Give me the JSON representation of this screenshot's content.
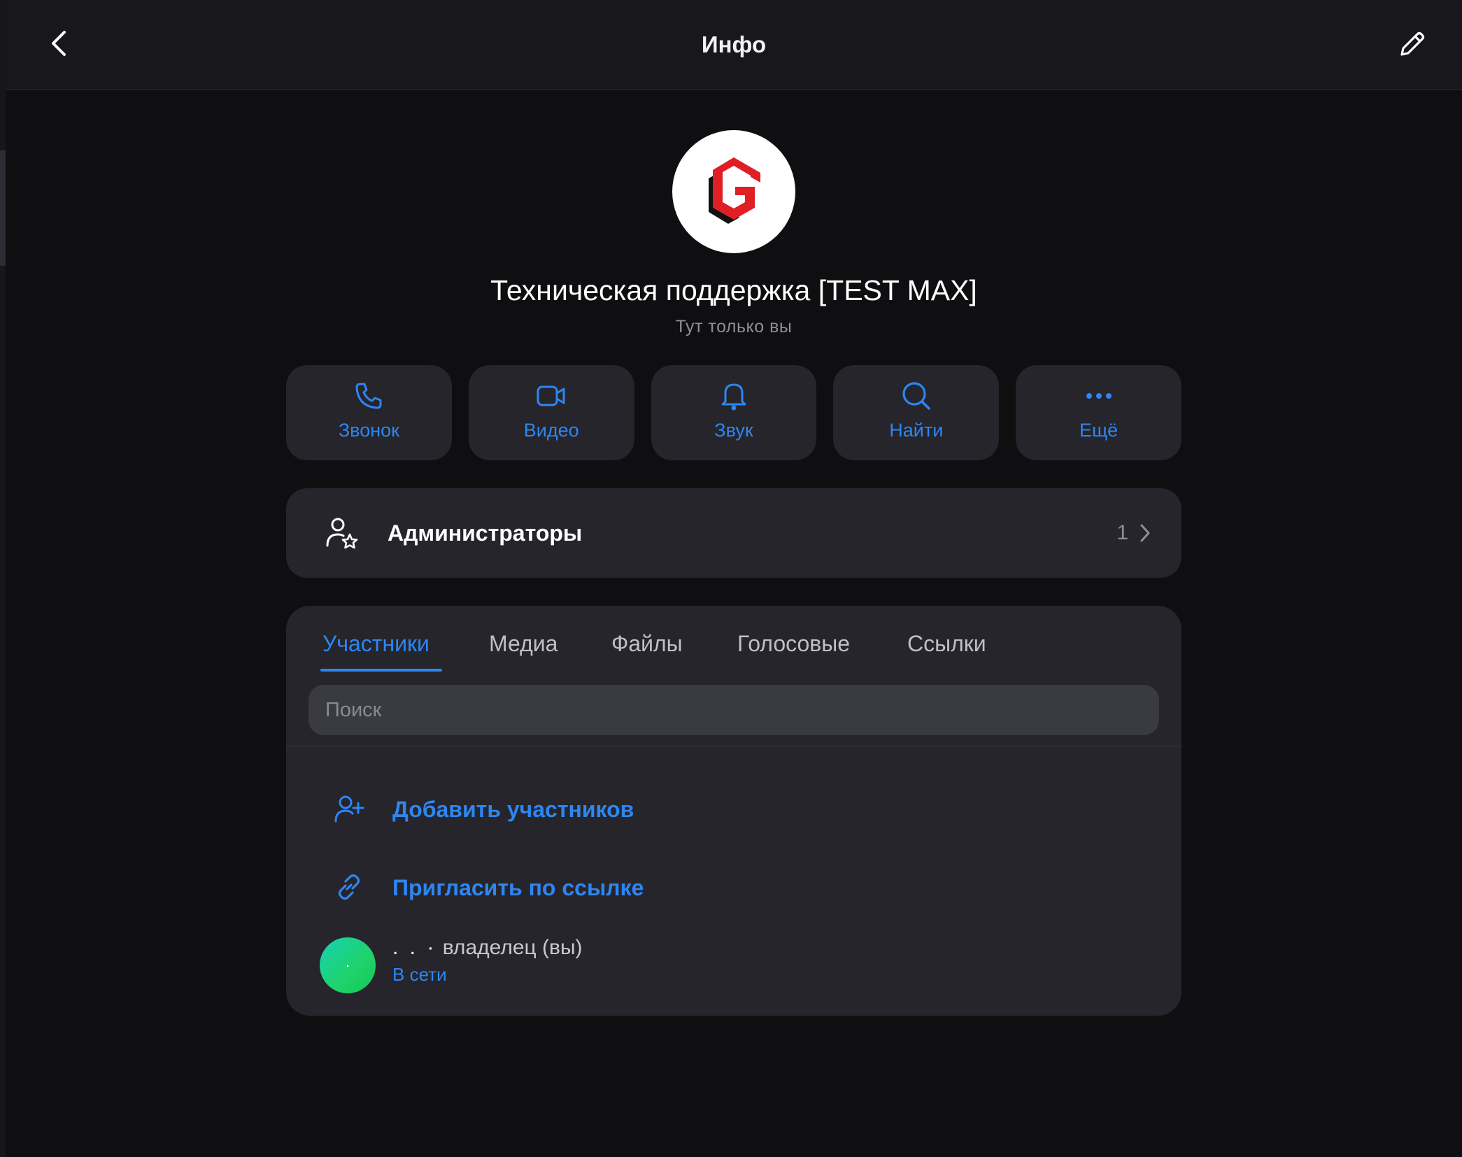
{
  "header": {
    "title": "Инфо",
    "back_icon": "chevron-left-icon",
    "edit_icon": "pencil-icon"
  },
  "group": {
    "name": "Техническая поддержка [TEST MAX]",
    "subtitle": "Тут только вы"
  },
  "actions": [
    {
      "label": "Звонок",
      "icon": "phone-icon"
    },
    {
      "label": "Видео",
      "icon": "video-icon"
    },
    {
      "label": "Звук",
      "icon": "bell-icon"
    },
    {
      "label": "Найти",
      "icon": "search-icon"
    },
    {
      "label": "Ещё",
      "icon": "more-icon"
    }
  ],
  "admins": {
    "label": "Администраторы",
    "count": "1"
  },
  "tabs": [
    {
      "label": "Участники",
      "active": true
    },
    {
      "label": "Медиа",
      "active": false
    },
    {
      "label": "Файлы",
      "active": false
    },
    {
      "label": "Голосовые",
      "active": false
    },
    {
      "label": "Ссылки",
      "active": false
    }
  ],
  "search": {
    "placeholder": "Поиск",
    "value": ""
  },
  "member_actions": {
    "add_label": "Добавить участников",
    "invite_label": "Пригласить по ссылке"
  },
  "members": [
    {
      "avatar_text": "·",
      "name_dots": ". . ·",
      "role": "владелец (вы)",
      "status": "В сети"
    }
  ],
  "colors": {
    "accent": "#2d86f3",
    "background": "#0f0f12",
    "card": "#25252b",
    "logo_red": "#e01e25"
  }
}
